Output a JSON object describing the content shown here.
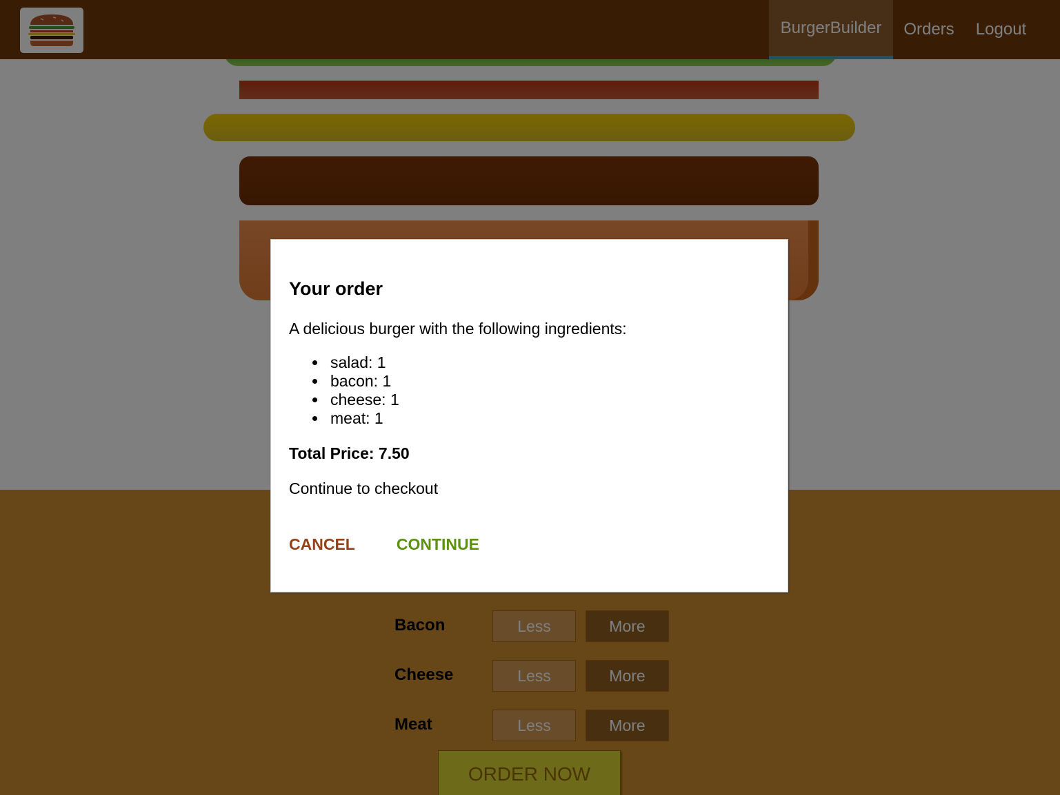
{
  "nav": {
    "items": [
      {
        "label": "BurgerBuilder",
        "active": true
      },
      {
        "label": "Orders",
        "active": false
      },
      {
        "label": "Logout",
        "active": false
      }
    ]
  },
  "burger": {
    "ingredients": [
      "salad",
      "bacon",
      "cheese",
      "meat"
    ]
  },
  "controls": {
    "rows": [
      {
        "label": "Bacon",
        "less": "Less",
        "more": "More"
      },
      {
        "label": "Cheese",
        "less": "Less",
        "more": "More"
      },
      {
        "label": "Meat",
        "less": "Less",
        "more": "More"
      }
    ],
    "order_label": "ORDER NOW"
  },
  "modal": {
    "title": "Your order",
    "description": "A delicious burger with the following ingredients:",
    "ingredients": [
      {
        "text": "salad: 1"
      },
      {
        "text": "bacon: 1"
      },
      {
        "text": "cheese: 1"
      },
      {
        "text": "meat: 1"
      }
    ],
    "total": "Total Price: 7.50",
    "checkout_prompt": "Continue to checkout",
    "cancel_label": "CANCEL",
    "continue_label": "CONTINUE"
  },
  "colors": {
    "toolbar": "#703b09",
    "controls_bg": "#cf8f2e",
    "cancel": "#944317",
    "continue": "#5c9210",
    "active_nav_border": "#40a4c8"
  }
}
